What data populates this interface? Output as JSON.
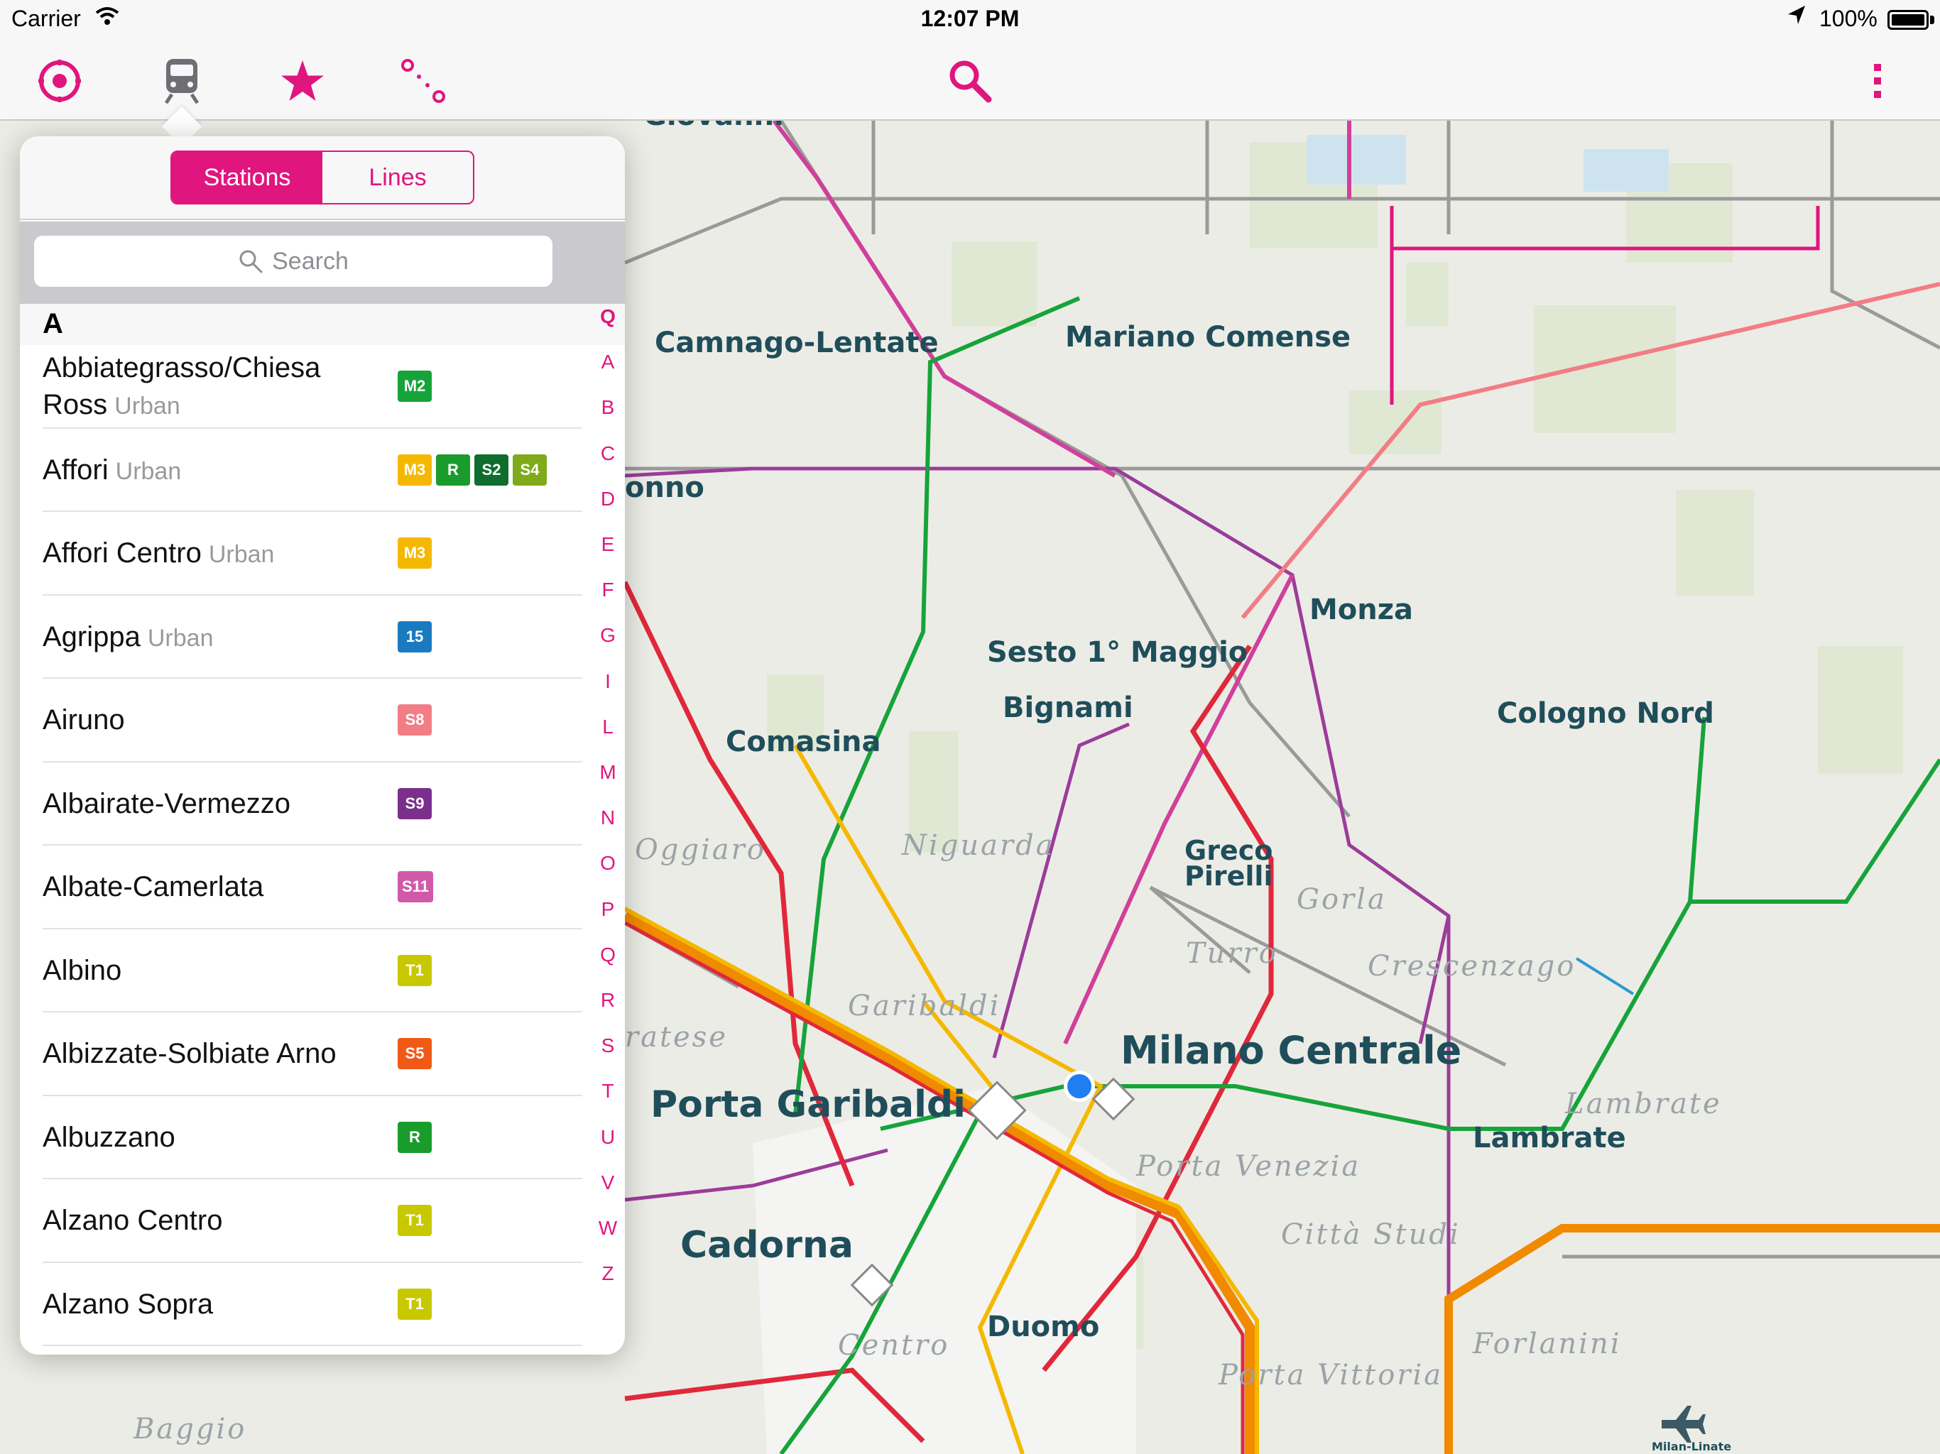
{
  "status": {
    "carrier": "Carrier",
    "time": "12:07 PM",
    "battery": "100%"
  },
  "toolbar": {
    "tabs": [
      {
        "name": "nearby-icon"
      },
      {
        "name": "train-icon"
      },
      {
        "name": "favorites-star-icon"
      },
      {
        "name": "route-planner-icon"
      }
    ],
    "search_icon": "search-icon",
    "more_icon": "more-vertical-icon",
    "accent_color": "#e0157e"
  },
  "popover": {
    "segments": [
      "Stations",
      "Lines"
    ],
    "active_segment": "Stations",
    "search_placeholder": "Search",
    "section": "A",
    "index": [
      "Q",
      "A",
      "B",
      "C",
      "D",
      "E",
      "F",
      "G",
      "I",
      "L",
      "M",
      "N",
      "O",
      "P",
      "Q",
      "R",
      "S",
      "T",
      "U",
      "V",
      "W",
      "Z"
    ],
    "stations": [
      {
        "name": "Abbiategrasso/Chiesa Ross",
        "kind": "Urban",
        "lines": [
          {
            "code": "M2",
            "color": "#16a43a"
          }
        ]
      },
      {
        "name": "Affori",
        "kind": "Urban",
        "lines": [
          {
            "code": "M3",
            "color": "#f5b800"
          },
          {
            "code": "R",
            "color": "#1a9c2c"
          },
          {
            "code": "S2",
            "color": "#0f6e2e"
          },
          {
            "code": "S4",
            "color": "#7faa1a"
          }
        ]
      },
      {
        "name": "Affori Centro",
        "kind": "Urban",
        "lines": [
          {
            "code": "M3",
            "color": "#f5b800"
          }
        ]
      },
      {
        "name": "Agrippa",
        "kind": "Urban",
        "lines": [
          {
            "code": "15",
            "color": "#1a7ac0"
          }
        ]
      },
      {
        "name": "Airuno",
        "kind": "",
        "lines": [
          {
            "code": "S8",
            "color": "#f27d85"
          }
        ]
      },
      {
        "name": "Albairate-Vermezzo",
        "kind": "",
        "lines": [
          {
            "code": "S9",
            "color": "#7b2f8c"
          }
        ]
      },
      {
        "name": "Albate-Camerlata",
        "kind": "",
        "lines": [
          {
            "code": "S11",
            "color": "#d05aa8"
          }
        ]
      },
      {
        "name": "Albino",
        "kind": "",
        "lines": [
          {
            "code": "T1",
            "color": "#c8c800"
          }
        ]
      },
      {
        "name": "Albizzate-Solbiate Arno",
        "kind": "",
        "lines": [
          {
            "code": "S5",
            "color": "#f05a16"
          }
        ]
      },
      {
        "name": "Albuzzano",
        "kind": "",
        "lines": [
          {
            "code": "R",
            "color": "#1a9c2c"
          }
        ]
      },
      {
        "name": "Alzano Centro",
        "kind": "",
        "lines": [
          {
            "code": "T1",
            "color": "#c8c800"
          }
        ]
      },
      {
        "name": "Alzano Sopra",
        "kind": "",
        "lines": [
          {
            "code": "T1",
            "color": "#c8c800"
          }
        ]
      }
    ]
  },
  "map": {
    "labels": {
      "camnago": "Camnago-Lentate",
      "mariano": "Mariano Comense",
      "monza": "Monza",
      "sesto": "Sesto 1° Maggio",
      "bignami": "Bignami",
      "comasina": "Comasina",
      "cologno": "Cologno Nord",
      "greco": "Greco Pirelli",
      "milano_centrale": "Milano Centrale",
      "porta_garibaldi": "Porta Garibaldi",
      "lambrate": "Lambrate",
      "cadorna": "Cadorna",
      "duomo": "Duomo",
      "onno": "onno",
      "giovanni": "Giovanni",
      "airport": "Milan-Linate"
    },
    "districts": {
      "oggiaro": "Oggiaro",
      "niguarda": "Niguarda",
      "gorla": "Gorla",
      "turro": "Turro",
      "crescenzago": "Crescenzago",
      "garibaldi": "Garibaldi",
      "ratese": "ratese",
      "lambrate": "Lambrate",
      "porta_venezia": "Porta Venezia",
      "citta_studi": "Città Studi",
      "forlanini": "Forlanini",
      "centro": "Centro",
      "porta_vittoria": "Porta Vittoria",
      "baggio": "Baggio"
    }
  }
}
